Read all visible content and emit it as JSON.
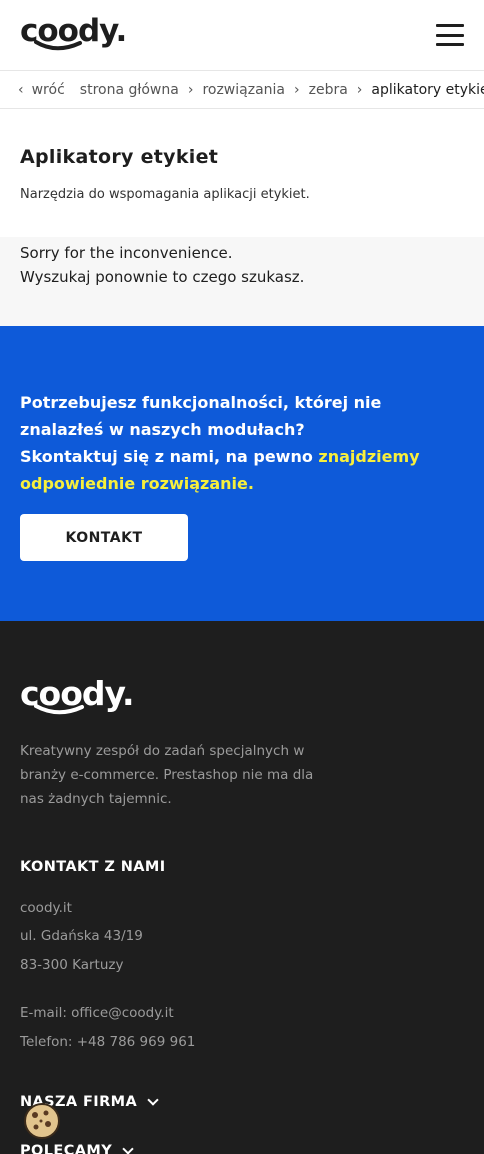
{
  "header": {
    "logo": "coody.",
    "menu_icon": "hamburger-icon"
  },
  "breadcrumb": {
    "back": "wróć",
    "items": [
      "strona główna",
      "rozwiązania",
      "zebra",
      "aplikatory etykiet"
    ]
  },
  "page": {
    "title": "Aplikatory etykiet",
    "description": "Narzędzia do wspomagania aplikacji etykiet."
  },
  "notice": {
    "line1": "Sorry for the inconvenience.",
    "line2": "Wyszukaj ponownie to czego szukasz."
  },
  "cta": {
    "text_part1": "Potrzebujesz funkcjonalności, której nie znalazłeś w naszych modułach?",
    "text_part2": "Skontaktuj się z nami, na pewno ",
    "highlight": "znajdziemy odpowiednie rozwiązanie.",
    "button": "KONTAKT",
    "bg_color": "#0e5ad9",
    "highlight_color": "#f7ef3c"
  },
  "footer": {
    "logo": "coody.",
    "about": "Kreatywny zespół do zadań specjalnych w branży e-commerce. Prestashop nie ma dla nas żadnych tajemnic.",
    "contact_heading": "KONTAKT Z NAMI",
    "company": "coody.it",
    "street": "ul. Gdańska 43/19",
    "city": "83-300 Kartuzy",
    "email": "E-mail: office@coody.it",
    "phone": "Telefon: +48 786 969 961",
    "section_company": "NASZA FIRMA",
    "section_recommend": "POLECAMY",
    "bg_color": "#1e1e1e"
  },
  "cookie_icon": "cookie-icon"
}
